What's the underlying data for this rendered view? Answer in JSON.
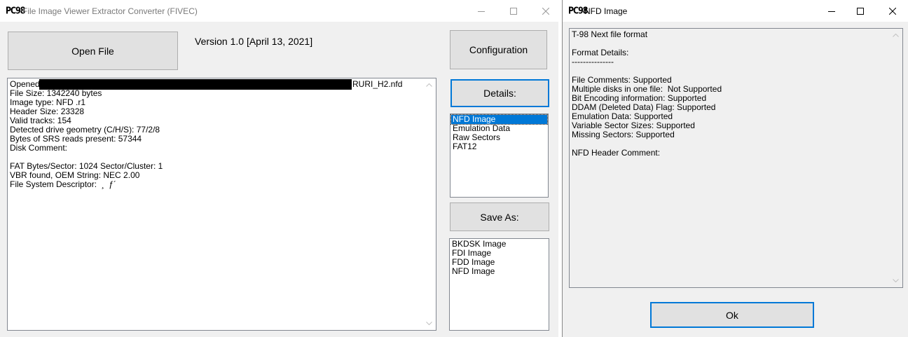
{
  "main_window": {
    "logo": "PC98",
    "title": "File Image Viewer Extractor Converter (FIVEC)",
    "open_button": "Open File",
    "version": "Version  1.0 [April 13, 2021]",
    "config_button": "Configuration",
    "details_button": "Details:",
    "save_button": "Save As:",
    "info_lines": [
      "Opened:",
      "File Size: 1342240 bytes",
      "Image type: NFD .r1",
      "Header Size: 23328",
      "Valid tracks: 154",
      "Detected drive geometry (C/H/S): 77/2/8",
      "Bytes of SRS reads present: 57344",
      "Disk Comment:",
      "",
      "FAT Bytes/Sector: 1024 Sector/Cluster: 1",
      "VBR found, OEM String: NEC 2.00",
      "File System Descriptor:  ¸  ƒ´"
    ],
    "opened_suffix": "RURI_H2.nfd",
    "details_items": [
      "NFD Image",
      "Emulation Data",
      "Raw Sectors",
      "FAT12"
    ],
    "details_selected": "NFD Image",
    "save_items": [
      "BKDSK Image",
      "FDI Image",
      "FDD Image",
      "NFD Image"
    ]
  },
  "dialog": {
    "logo": "PC98",
    "title": "NFD Image",
    "lines": [
      "T-98 Next file format",
      "",
      "Format Details:",
      "---------------",
      "",
      "File Comments: Supported",
      "Multiple disks in one file:  Not Supported",
      "Bit Encoding information: Supported",
      "DDAM (Deleted Data) Flag: Supported",
      "Emulation Data: Supported",
      "Variable Sector Sizes: Supported",
      "Missing Sectors: Supported",
      "",
      "NFD Header Comment:"
    ],
    "ok_button": "Ok"
  }
}
